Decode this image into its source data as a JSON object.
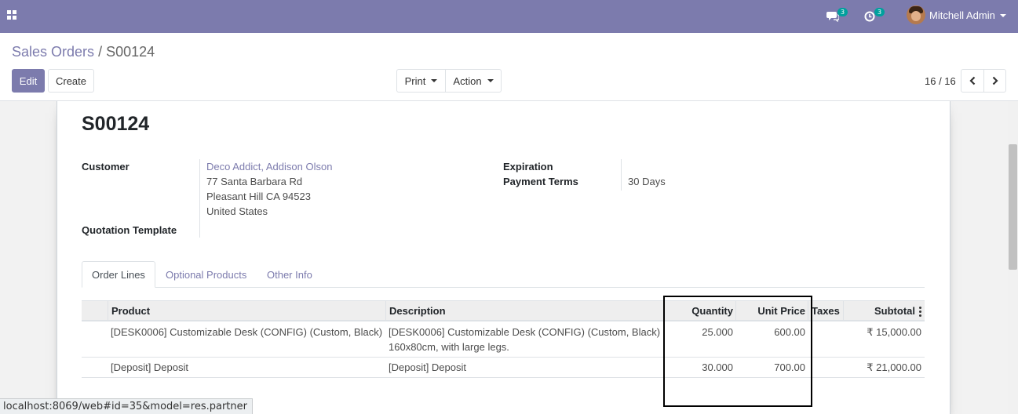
{
  "navbar": {
    "messages_badge": "3",
    "activity_badge": "3",
    "user_name": "Mitchell Admin"
  },
  "breadcrumb": {
    "parent": "Sales Orders",
    "separator": "/",
    "current": "S00124"
  },
  "buttons": {
    "edit": "Edit",
    "create": "Create",
    "print": "Print",
    "action": "Action"
  },
  "pager": {
    "value": "16 / 16"
  },
  "order": {
    "name": "S00124",
    "customer_label": "Customer",
    "customer_name": "Deco Addict, Addison Olson",
    "address_line1": "77 Santa Barbara Rd",
    "address_line2": "Pleasant Hill CA 94523",
    "address_line3": "United States",
    "quotation_template_label": "Quotation Template",
    "expiration_label": "Expiration",
    "payment_terms_label": "Payment Terms",
    "payment_terms_value": "30 Days"
  },
  "tabs": [
    {
      "label": "Order Lines",
      "active": true
    },
    {
      "label": "Optional Products",
      "active": false
    },
    {
      "label": "Other Info",
      "active": false
    }
  ],
  "table": {
    "columns": [
      "Product",
      "Description",
      "Quantity",
      "Unit Price",
      "Taxes",
      "Subtotal"
    ],
    "rows": [
      {
        "product": "[DESK0006] Customizable Desk (CONFIG) (Custom, Black)",
        "description_line1": "[DESK0006] Customizable Desk (CONFIG) (Custom, Black)",
        "description_line2": "160x80cm, with large legs.",
        "quantity": "25.000",
        "unit_price": "600.00",
        "taxes": "",
        "subtotal": "₹ 15,000.00"
      },
      {
        "product": "[Deposit] Deposit",
        "description_line1": "[Deposit] Deposit",
        "description_line2": "",
        "quantity": "30.000",
        "unit_price": "700.00",
        "taxes": "",
        "subtotal": "₹ 21,000.00"
      }
    ]
  },
  "status_bar": {
    "url": "localhost:8069/web#id=35&model=res.partner"
  },
  "colors": {
    "brand": "#7c7bad",
    "badge": "#00a09d"
  }
}
